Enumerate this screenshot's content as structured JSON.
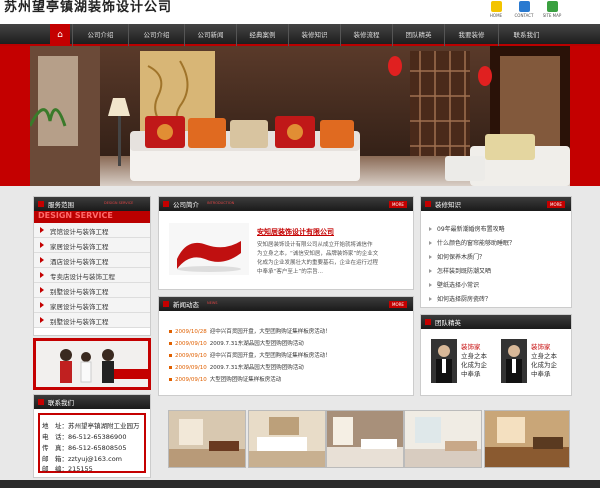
{
  "header": {
    "logo_text": "苏州望亭镇湖装饰设计公司",
    "top_links": [
      {
        "label": "HOME",
        "icon": "home-icon"
      },
      {
        "label": "CONTACT",
        "icon": "mail-icon"
      },
      {
        "label": "SITE MAP",
        "icon": "sitemap-icon"
      }
    ]
  },
  "nav": {
    "home_icon": "⌂",
    "items": [
      "公司介绍",
      "公司介绍",
      "公司新闻",
      "经典案例",
      "装修知识",
      "装修流程",
      "团队精英",
      "我要装修",
      "联系我们"
    ]
  },
  "sidebar": {
    "services_title": "服务范围",
    "services_sub": "DESIGN SERVICE",
    "services_big": "DESIGN SERVICE",
    "services": [
      "宾馆设计与装饰工程",
      "家居设计与装饰工程",
      "酒店设计与装饰工程",
      "专卖店设计与装饰工程",
      "别墅设计与装饰工程",
      "家居设计与装饰工程",
      "别墅设计与装饰工程"
    ],
    "contact_title": "联系我们",
    "contact": [
      {
        "label": "地　址：",
        "value": "苏州望亭镇湖附工业园万"
      },
      {
        "label": "电　话：",
        "value": "86-512-65386900"
      },
      {
        "label": "传　真：",
        "value": "86-512-65808505"
      },
      {
        "label": "邮　箱：",
        "value": "zztyuj@163.com"
      },
      {
        "label": "邮　编：",
        "value": "215155"
      }
    ]
  },
  "about": {
    "title": "公司简介",
    "sub": "INTRODUCTION",
    "more": "MORE",
    "company_name": "安知居装饰设计有限公司",
    "desc_lines": [
      "安知居装饰设计有限公司从成立开始就将诚信作",
      "为立身之本，“诚信安知居，品牌装饰家”的企业文",
      "化成为企业发展壮大的重要基石，企业在运行过程",
      "中奉承“客户至上”的宗旨..."
    ]
  },
  "news": {
    "title": "新闻动态",
    "sub": "NEWS",
    "more": "MORE",
    "items": [
      {
        "date": "2009/10/28",
        "text": "迎中兴百货园开盘，大型团购购证集样板房活动！"
      },
      {
        "date": "2009/09/10",
        "text": "2009.7.31东湖品园大型团购团购活动"
      },
      {
        "date": "2009/09/10",
        "text": "迎中兴百货园开盘，大型团购购证集样板房活动！"
      },
      {
        "date": "2009/09/10",
        "text": "2009.7.31东湖品园大型团购团购活动"
      },
      {
        "date": "2009/09/10",
        "text": "大型团购团购证集样板房活动"
      }
    ]
  },
  "knowledge": {
    "title": "装修知识",
    "more": "MORE",
    "items": [
      "09年最新潮婚房布置攻略",
      "什么颜色的窗帘能够助睡眠？",
      "如何保养木质门？",
      "怎样装到既防潮又晒",
      "壁纸选择小常识",
      "如何选择厨房瓷砖？"
    ]
  },
  "team": {
    "title": "团队精英",
    "members": [
      {
        "name": "装饰家",
        "lines": [
          "立身之本",
          "化成为企",
          "中奉承"
        ]
      },
      {
        "name": "装饰家",
        "lines": [
          "立身之本",
          "化成为企",
          "中奉承"
        ]
      }
    ]
  },
  "colors": {
    "accent": "#c40000",
    "dark": "#1e1e1e"
  }
}
